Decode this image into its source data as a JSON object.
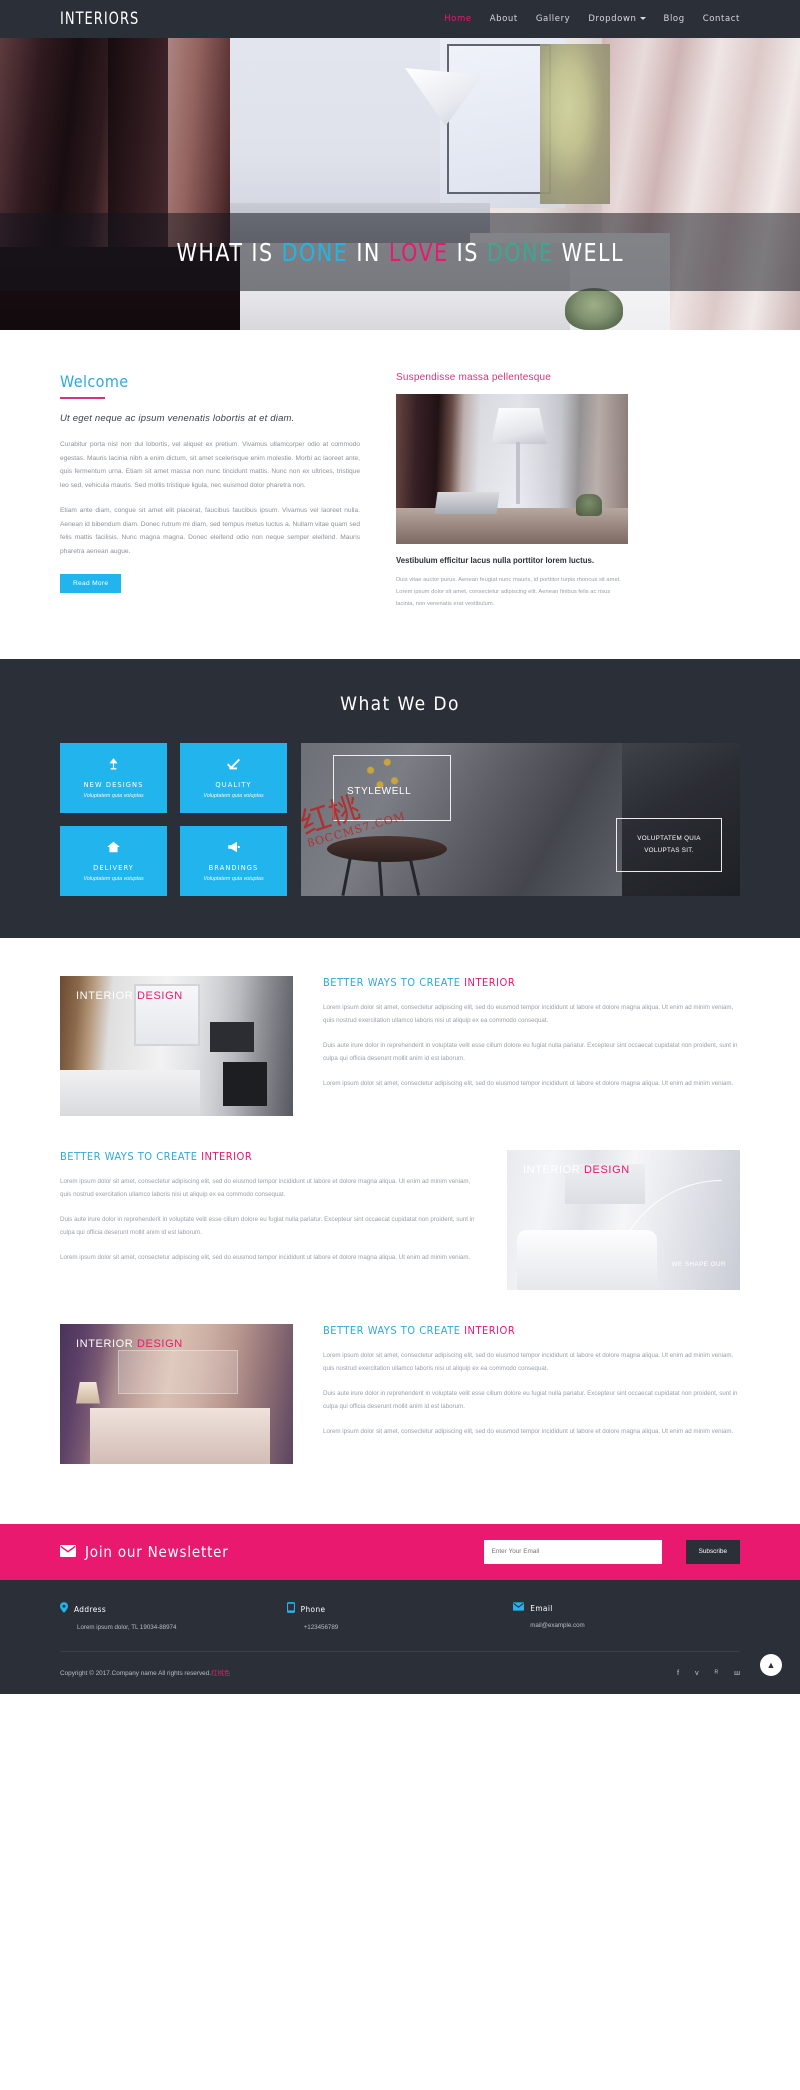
{
  "header": {
    "logo": "INTERIORS",
    "nav": [
      {
        "label": "Home",
        "active": true
      },
      {
        "label": "About",
        "active": false
      },
      {
        "label": "Gallery",
        "active": false
      },
      {
        "label": "Dropdown",
        "active": false,
        "caret": true
      },
      {
        "label": "Blog",
        "active": false
      },
      {
        "label": "Contact",
        "active": false
      }
    ]
  },
  "hero": {
    "title_parts": [
      {
        "text": "WHAT IS ",
        "color": "#ffffff"
      },
      {
        "text": "DONE",
        "color": "#23b5e2"
      },
      {
        "text": " IN ",
        "color": "#ffffff"
      },
      {
        "text": "LOVE",
        "color": "#e8196f"
      },
      {
        "text": " IS ",
        "color": "#ffffff"
      },
      {
        "text": "DONE",
        "color": "#3ba890"
      },
      {
        "text": "  WELL",
        "color": "#ffffff"
      }
    ],
    "full_title": "WHAT IS DONE IN LOVE IS DONE WELL"
  },
  "welcome": {
    "title": "Welcome",
    "lead": "Ut eget neque ac ipsum venenatis lobortis at et diam.",
    "para1": "Curabitur porta nisl non dui lobortis, vel aliquet ex pretium. Vivamus ullamcorper odio at commodo egestas. Mauris lacinia nibh a enim dictum, sit amet scelerisque enim molestie. Morbi ac laoreet ante, quis fermentum urna. Etiam sit amet massa non nunc tincidunt mattis. Nunc non ex ultrices, tristique leo sed, vehicula mauris. Sed mollis tristique ligula, nec euismod dolor pharetra non.",
    "para2": "Etiam ante diam, congue sit amet elit placerat, faucibus faucibus ipsum. Vivamus vel laoreet nulla. Aenean id bibendum diam. Donec rutrum mi diam, sed tempus metus luctus a. Nullam vitae quam sed felis mattis facilisis. Nunc magna magna. Donec eleifend odio non neque semper eleifend. Mauris pharetra aenean augue.",
    "read_more": "Read More",
    "right_title": "Suspendisse massa pellentesque",
    "caption_title": "Vestibulum efficitur lacus nulla porttitor lorem luctus.",
    "caption_para": "Duis vitae auctor purus. Aenean feugiat nunc mauris, id porttitor turpis rhoncus sit amet. Lorem ipsum dolor sit amet, consectetur adipiscing elit. Aenean finibus felis ac risus lacinia, non venenatis erat vestibulum."
  },
  "what_we_do": {
    "title": "What We Do",
    "services": [
      {
        "icon": "lamp-icon",
        "glyph": "☂",
        "name": "NEW DESIGNS",
        "sub": "Voluptatem quia voluptas"
      },
      {
        "icon": "check-ruler-icon",
        "glyph": "✔",
        "name": "QUALITY",
        "sub": "Voluptatem quia voluptas"
      },
      {
        "icon": "home-icon",
        "glyph": "⌂",
        "name": "DELIVERY",
        "sub": "Voluptatem quia voluptas"
      },
      {
        "icon": "megaphone-icon",
        "glyph": "▶",
        "name": "BRANDINGS",
        "sub": "Voluptatem quia voluptas"
      }
    ],
    "image_label_main": "STYLEWELL",
    "image_label_box_line1": "VOLUPTATEM QUIA",
    "image_label_box_line2": "VOLUPTAS SIT.",
    "watermark": "红桃",
    "watermark_sub": "8OCCMS7.COM"
  },
  "features": [
    {
      "overlay_line1": "INTERIOR",
      "overlay_line2": "DESIGN",
      "image_name": "bedroom-desk-image",
      "image_side": "left",
      "title_a": "BETTER WAYS TO CREATE ",
      "title_b": "INTERIOR",
      "p1": "Lorem ipsum dolor sit amet, consectetur adipiscing elit, sed do eiusmod tempor incididunt ut labore et dolore magna aliqua. Ut enim ad minim veniam, quis nostrud exercitation ullamco laboris nisi ut aliquip ex ea commodo consequat.",
      "p2": "Duis aute irure dolor in reprehenderit in voluptate velit esse cillum dolore eu fugiat nulla pariatur. Excepteur sint occaecat cupidatat non proident, sunt in culpa qui officia deserunt mollit anim id est laborum.",
      "p3": "Lorem ipsum dolor sit amet, consectetur adipiscing elit, sed do eiusmod tempor incididunt ut labore et dolore magna aliqua. Ut enim ad minim veniam."
    },
    {
      "overlay_line1": "INTERIOR",
      "overlay_line2": "DESIGN",
      "overlay_extra": "WE SHAPE OUR",
      "image_name": "living-room-image",
      "image_side": "right",
      "title_a": "BETTER WAYS TO CREATE ",
      "title_b": "INTERIOR",
      "p1": "Lorem ipsum dolor sit amet, consectetur adipiscing elit, sed do eiusmod tempor incididunt ut labore et dolore magna aliqua. Ut enim ad minim veniam, quis nostrud exercitation ullamco laboris nisi ut aliquip ex ea commodo consequat.",
      "p2": "Duis aute irure dolor in reprehenderit in voluptate velit esse cillum dolore eu fugiat nulla pariatur. Excepteur sint occaecat cupidatat non proident, sunt in culpa qui officia deserunt mollit anim id est laborum.",
      "p3": "Lorem ipsum dolor sit amet, consectetur adipiscing elit, sed do eiusmod tempor incididunt ut labore et dolore magna aliqua. Ut enim ad minim veniam."
    },
    {
      "overlay_line1": "INTERIOR",
      "overlay_line2": "DESIGN",
      "image_name": "purple-bedroom-image",
      "image_side": "left",
      "title_a": "BETTER WAYS TO CREATE ",
      "title_b": "INTERIOR",
      "p1": "Lorem ipsum dolor sit amet, consectetur adipiscing elit, sed do eiusmod tempor incididunt ut labore et dolore magna aliqua. Ut enim ad minim veniam, quis nostrud exercitation ullamco laboris nisi ut aliquip ex ea commodo consequat.",
      "p2": "Duis aute irure dolor in reprehenderit in voluptate velit esse cillum dolore eu fugiat nulla pariatur. Excepteur sint occaecat cupidatat non proident, sunt in culpa qui officia deserunt mollit anim id est laborum.",
      "p3": "Lorem ipsum dolor sit amet, consectetur adipiscing elit, sed do eiusmod tempor incididunt ut labore et dolore magna aliqua. Ut enim ad minim veniam."
    }
  ],
  "newsletter": {
    "title": "Join our Newsletter",
    "placeholder": "Enter Your Email",
    "value": "",
    "button": "Subscribe"
  },
  "footer": {
    "contacts": [
      {
        "icon": "location-pin-icon",
        "glyph": "⚉",
        "label": "Address",
        "value": "Lorem ipsum dolor, TL 19034-88974"
      },
      {
        "icon": "phone-icon",
        "glyph": "☎",
        "label": "Phone",
        "value": "+123456789"
      },
      {
        "icon": "envelope-icon",
        "glyph": "✉",
        "label": "Email",
        "value": "mail@example.com"
      }
    ],
    "copyright": "Copyright © 2017.Company name All rights reserved.",
    "copyright_suffix": "红桃色",
    "socials": [
      {
        "name": "facebook-icon",
        "glyph": "f"
      },
      {
        "name": "twitter-icon",
        "glyph": "ᴠ"
      },
      {
        "name": "rss-icon",
        "glyph": "ᴿ"
      },
      {
        "name": "vk-icon",
        "glyph": "ш"
      }
    ],
    "to_top": "▲"
  },
  "colors": {
    "dark": "#2b2f38",
    "cyan": "#22b4ec",
    "pink": "#e8196f",
    "teal": "#3ba890"
  }
}
